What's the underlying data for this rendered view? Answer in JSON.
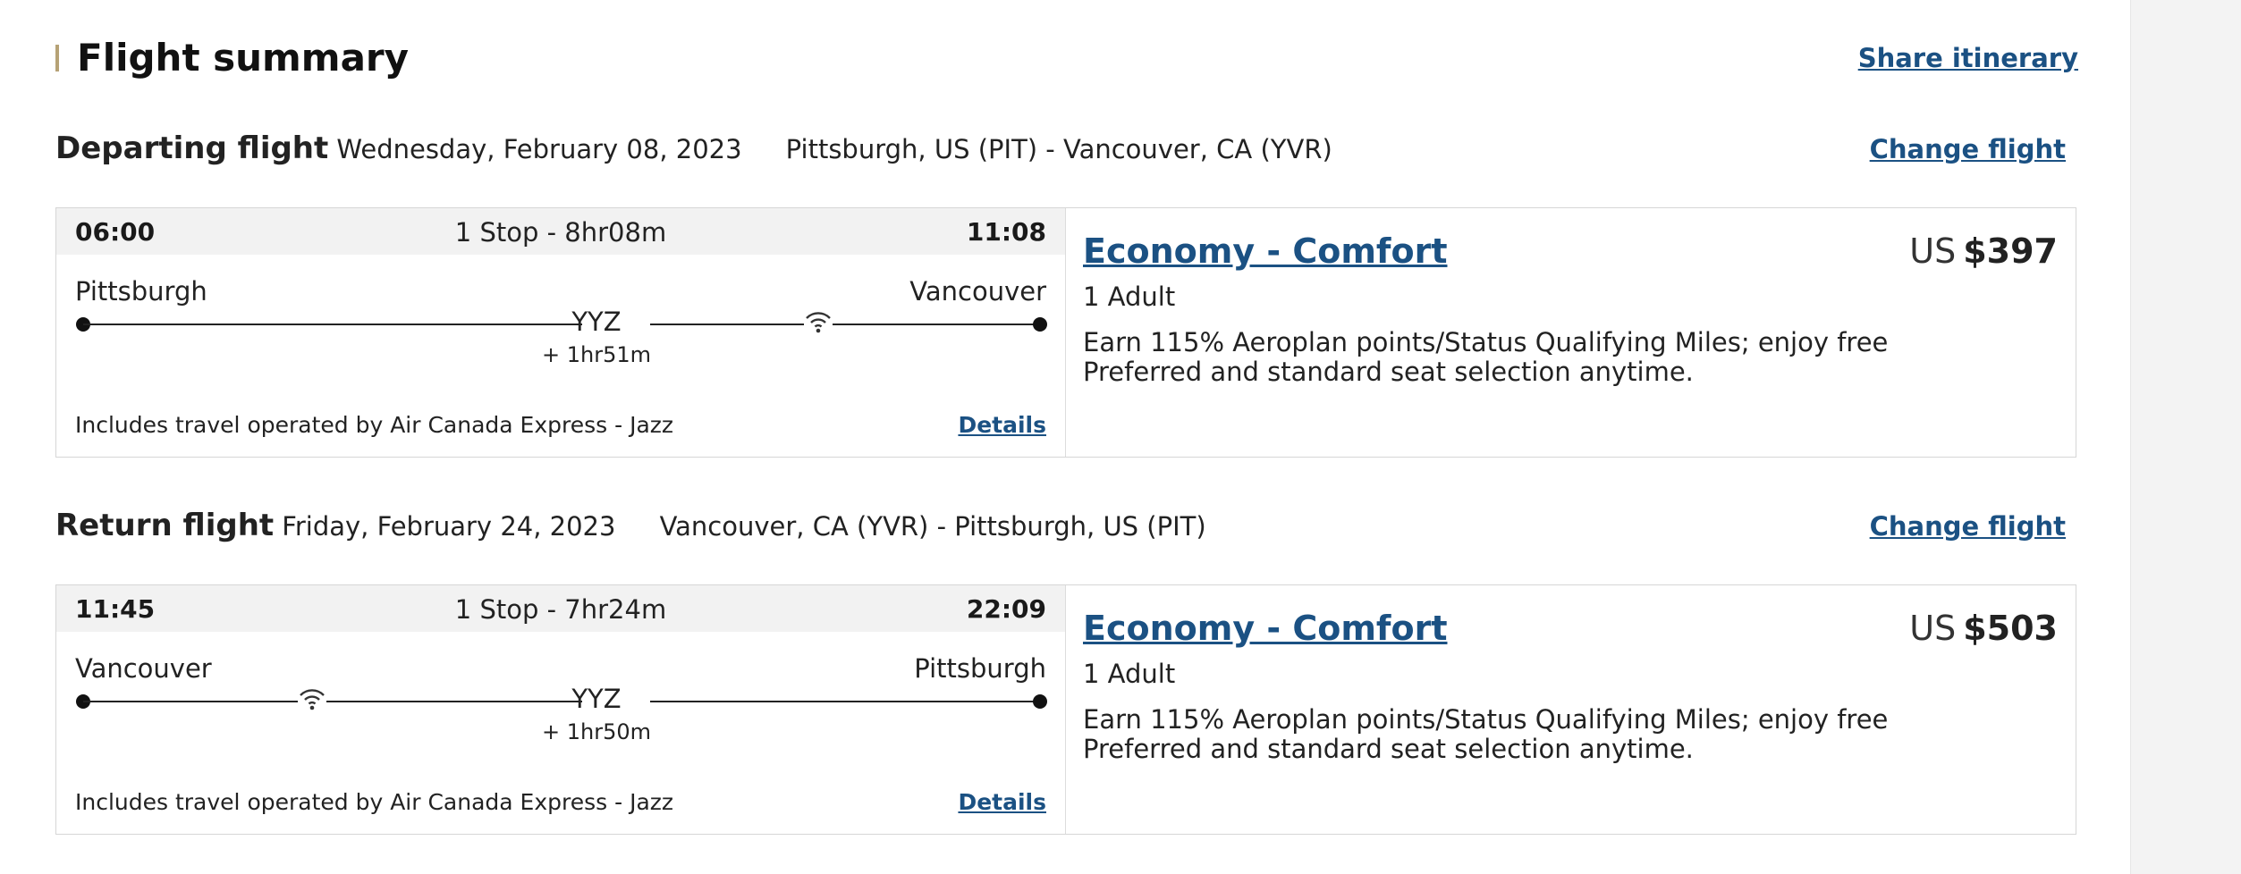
{
  "summary": {
    "title": "Flight summary",
    "share_label": "Share itinerary"
  },
  "colors": {
    "accent": "#b6a276",
    "link": "#1b5183"
  },
  "departing": {
    "heading": "Departing flight",
    "date": "Wednesday, February 08, 2023",
    "route": "Pittsburgh, US (PIT) - Vancouver, CA (YVR)",
    "change_label": "Change flight",
    "dep_time": "06:00",
    "arr_time": "11:08",
    "stops": "1 Stop - 8hr08m",
    "from_city": "Pittsburgh",
    "to_city": "Vancouver",
    "stop_code": "YYZ",
    "layover": "+ 1hr51m",
    "wifi_icon": "wifi-icon",
    "operated_by": "Includes travel operated by Air Canada Express - Jazz",
    "details_label": "Details",
    "fare_name": "Economy - Comfort",
    "currency": "US",
    "price": "$397",
    "passengers": "1 Adult",
    "benefit": "Earn 115% Aeroplan points/Status Qualifying Miles; enjoy free Preferred and standard seat selection anytime."
  },
  "return": {
    "heading": "Return flight",
    "date": "Friday, February 24, 2023",
    "route": "Vancouver, CA (YVR) - Pittsburgh, US (PIT)",
    "change_label": "Change flight",
    "dep_time": "11:45",
    "arr_time": "22:09",
    "stops": "1 Stop - 7hr24m",
    "from_city": "Vancouver",
    "to_city": "Pittsburgh",
    "stop_code": "YYZ",
    "layover": "+ 1hr50m",
    "wifi_icon": "wifi-icon",
    "operated_by": "Includes travel operated by Air Canada Express - Jazz",
    "details_label": "Details",
    "fare_name": "Economy - Comfort",
    "currency": "US",
    "price": "$503",
    "passengers": "1 Adult",
    "benefit": "Earn 115% Aeroplan points/Status Qualifying Miles; enjoy free Preferred and standard seat selection anytime."
  }
}
